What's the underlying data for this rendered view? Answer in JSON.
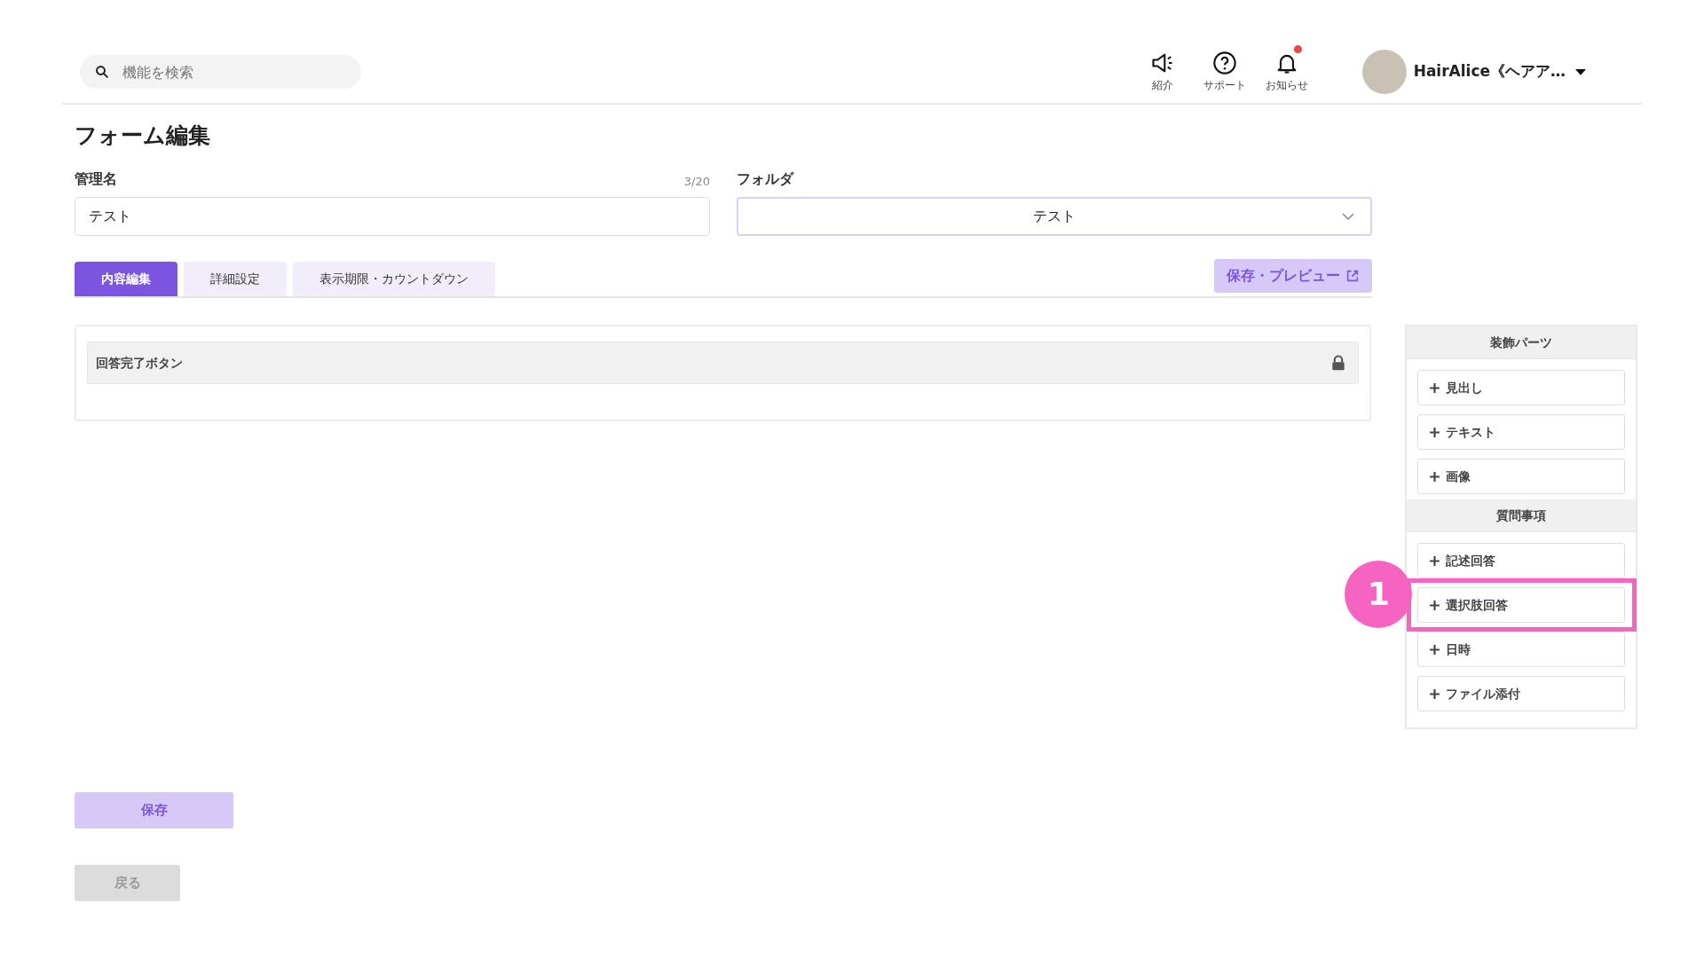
{
  "header": {
    "search": {
      "placeholder": "機能を検索"
    },
    "icons": [
      {
        "kind": "megaphone",
        "label": "紹介",
        "unread": false
      },
      {
        "kind": "help",
        "label": "サポート",
        "unread": false
      },
      {
        "kind": "bell",
        "label": "お知らせ",
        "unread": true
      }
    ],
    "account": {
      "name": "HairAlice《ヘアア…"
    }
  },
  "page_title": "フォーム編集",
  "fields": {
    "name": {
      "label": "管理名",
      "counter": "3/20",
      "value": "テスト"
    },
    "folder": {
      "label": "フォルダ",
      "value": "テスト"
    }
  },
  "tabs": [
    {
      "label": "内容編集",
      "selected": true
    },
    {
      "label": "詳細設定",
      "selected": false
    },
    {
      "label": "表示期限・カウントダウン",
      "selected": false
    }
  ],
  "preview_button": "保存・プレビュー",
  "form_items": [
    {
      "label": "回答完了ボタン",
      "locked": true
    }
  ],
  "palette": [
    {
      "title": "装飾パーツ",
      "items": [
        {
          "label": "見出し",
          "highlighted": false
        },
        {
          "label": "テキスト",
          "highlighted": false
        },
        {
          "label": "画像",
          "highlighted": false
        }
      ]
    },
    {
      "title": "質問事項",
      "items": [
        {
          "label": "記述回答",
          "highlighted": false
        },
        {
          "label": "選択肢回答",
          "highlighted": true,
          "annotation": "1"
        },
        {
          "label": "日時",
          "highlighted": false
        },
        {
          "label": "ファイル添付",
          "highlighted": false
        }
      ]
    }
  ],
  "save_button": "保存",
  "back_button": "戻る"
}
